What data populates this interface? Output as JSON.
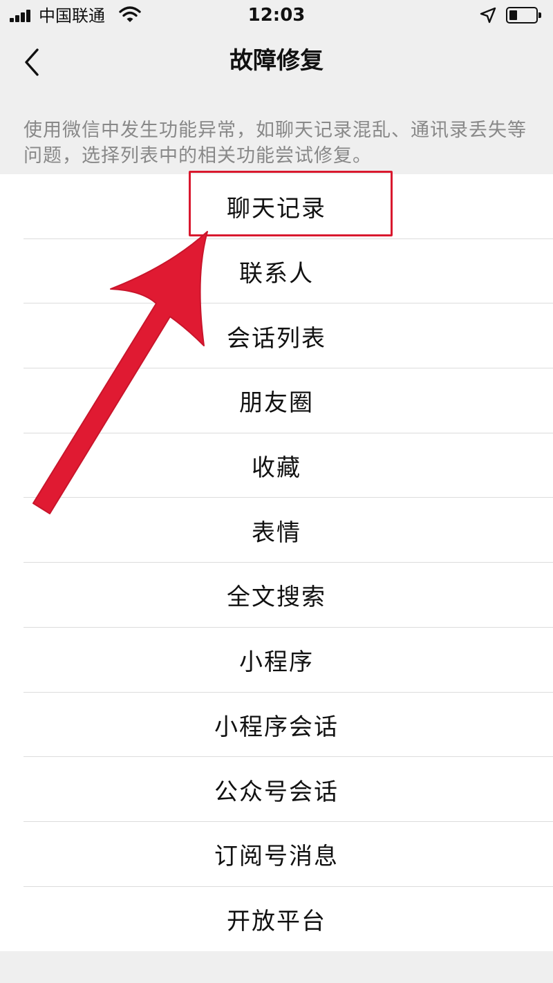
{
  "status_bar": {
    "carrier": "中国联通",
    "time": "12:03",
    "signal_bars": 4,
    "icons": [
      "signal-icon",
      "wifi-icon",
      "location-icon",
      "battery-icon"
    ]
  },
  "nav": {
    "title": "故障修复",
    "back_icon": "chevron-left-icon"
  },
  "description": "使用微信中发生功能异常，如聊天记录混乱、通讯录丢失等问题，选择列表中的相关功能尝试修复。",
  "items": [
    {
      "label": "聊天记录"
    },
    {
      "label": "联系人"
    },
    {
      "label": "会话列表"
    },
    {
      "label": "朋友圈"
    },
    {
      "label": "收藏"
    },
    {
      "label": "表情"
    },
    {
      "label": "全文搜索"
    },
    {
      "label": "小程序"
    },
    {
      "label": "小程序会话"
    },
    {
      "label": "公众号会话"
    },
    {
      "label": "订阅号消息"
    },
    {
      "label": "开放平台"
    }
  ],
  "annotation": {
    "highlighted_item": "聊天记录",
    "color": "#d9182e"
  },
  "colors": {
    "background": "#efefef",
    "list_background": "#ffffff",
    "description_text": "#888888",
    "annotation_red": "#d9182e"
  }
}
